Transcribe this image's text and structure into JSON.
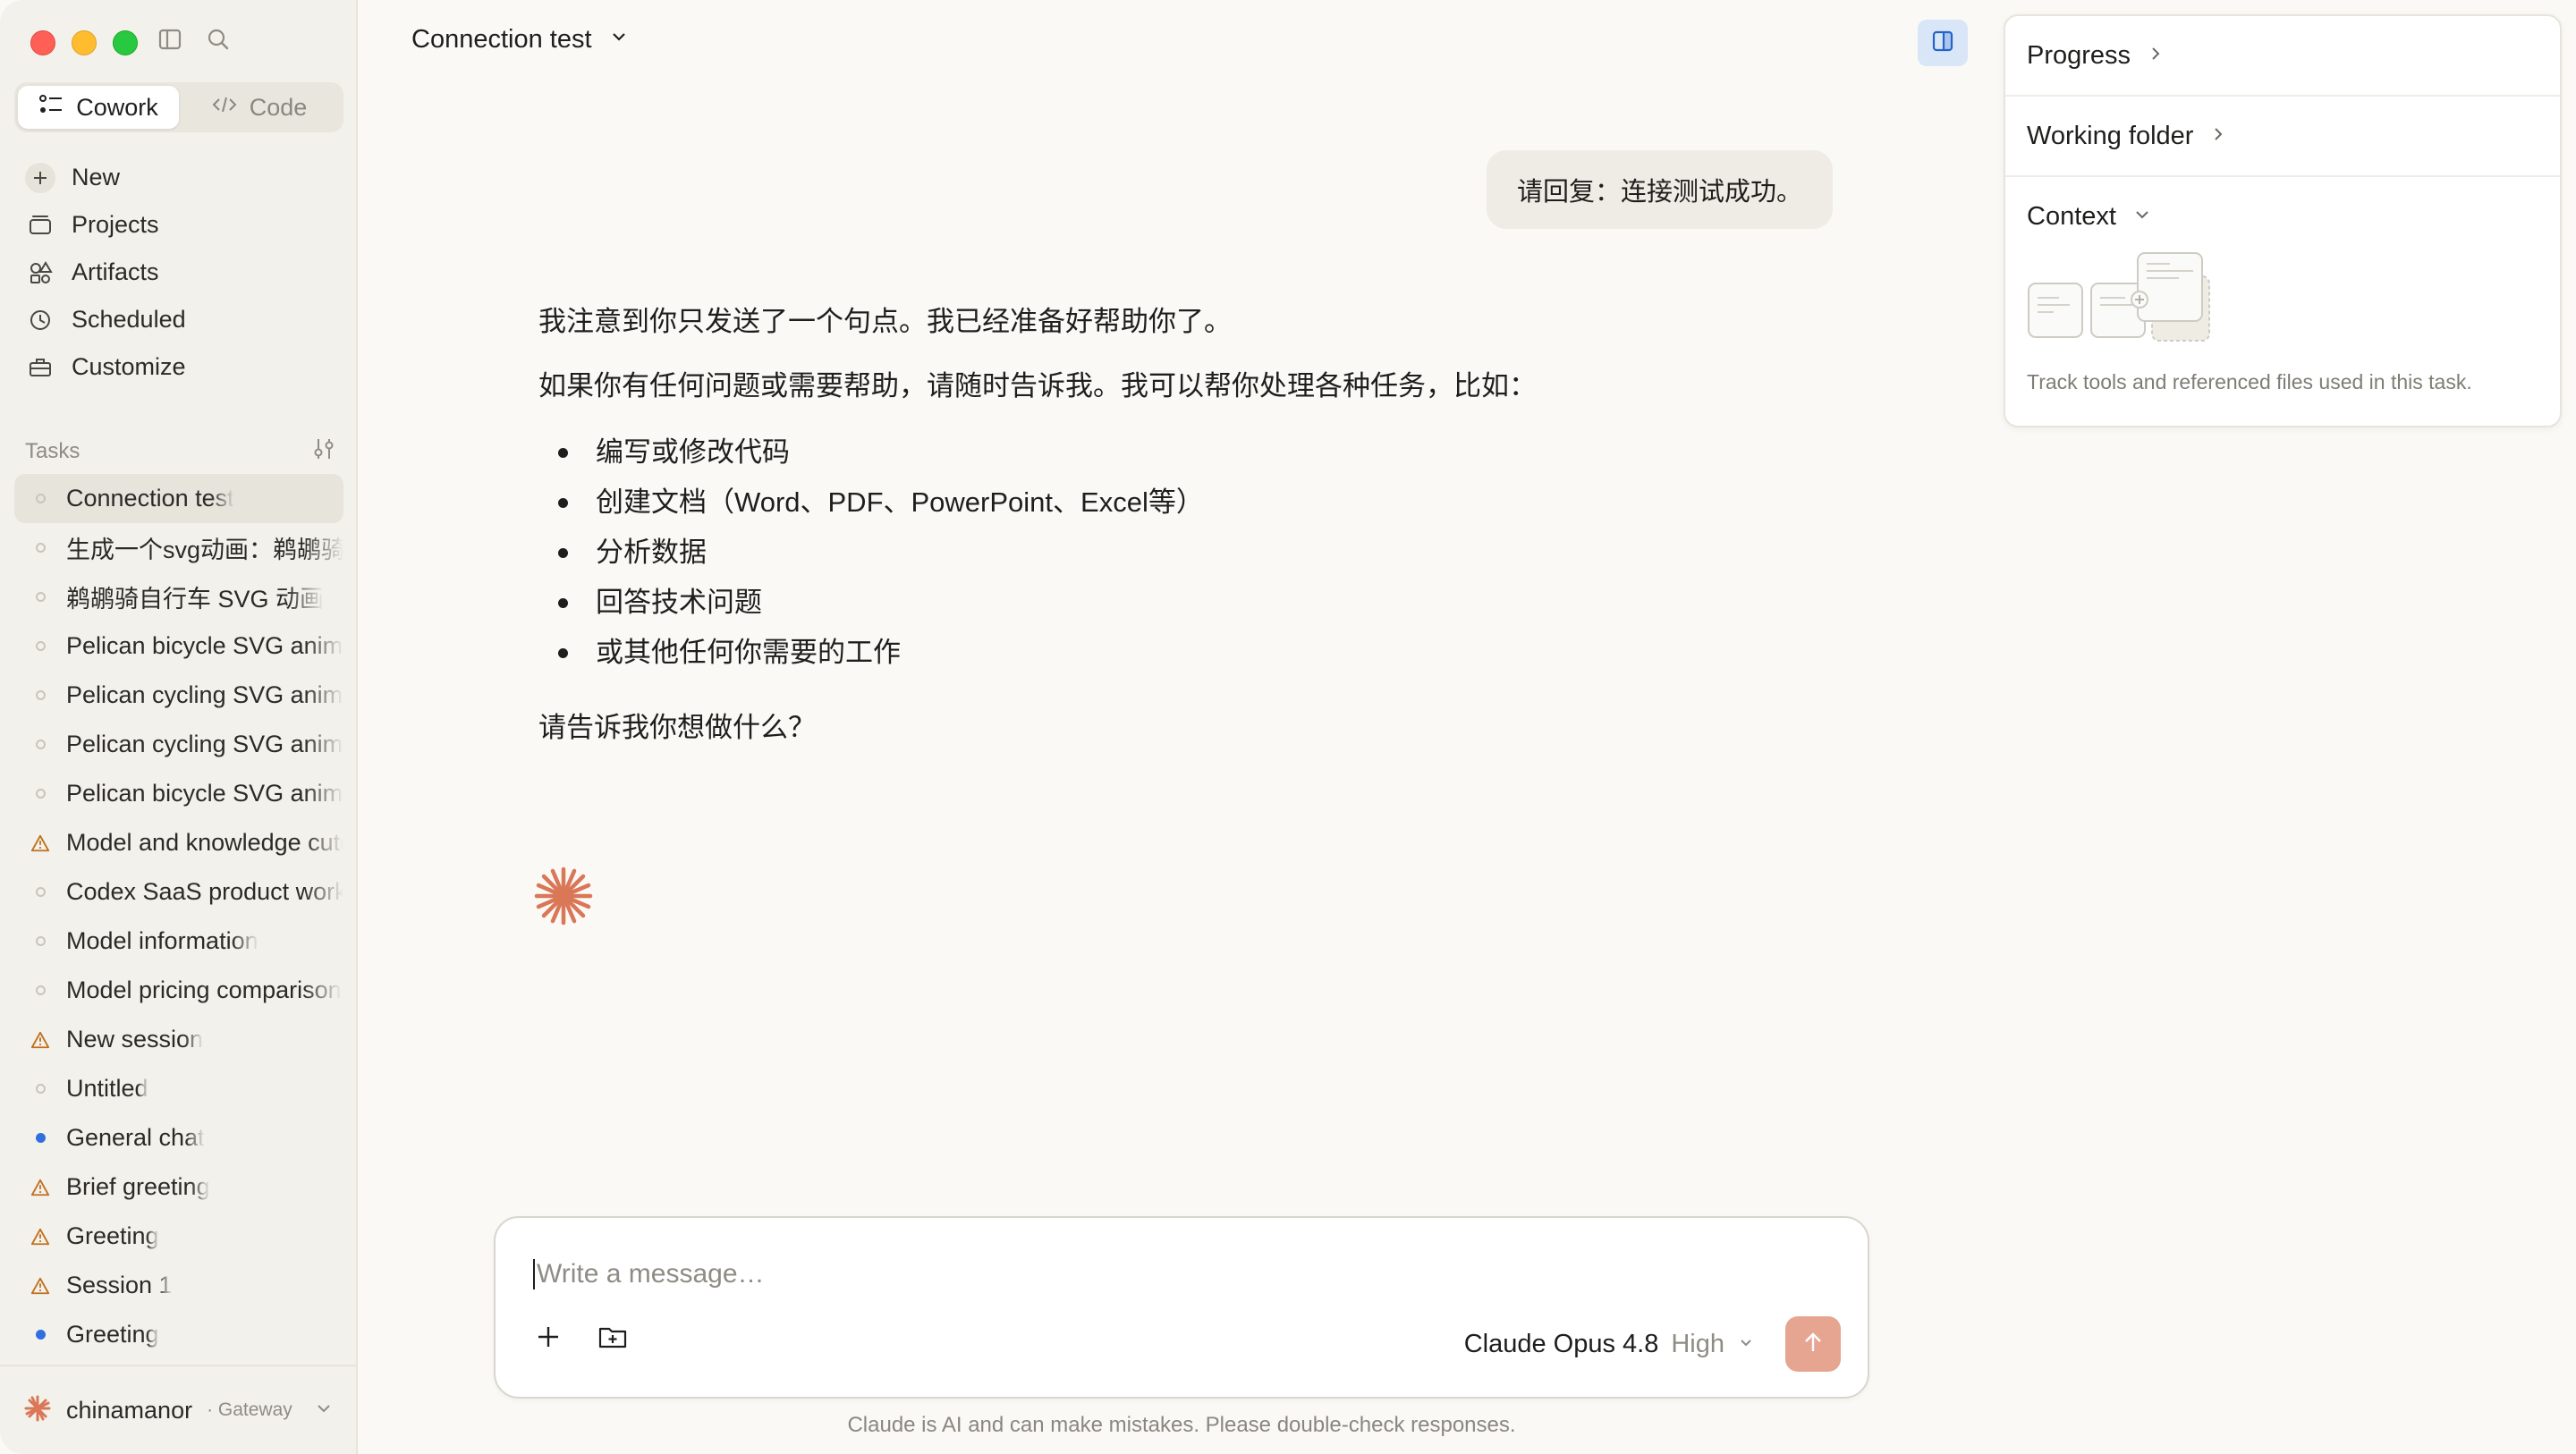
{
  "sidebar": {
    "modes": [
      {
        "label": "Cowork",
        "active": true
      },
      {
        "label": "Code",
        "active": false
      }
    ],
    "nav": [
      {
        "label": "New",
        "icon": "plus-icon"
      },
      {
        "label": "Projects",
        "icon": "folder-icon"
      },
      {
        "label": "Artifacts",
        "icon": "shapes-icon"
      },
      {
        "label": "Scheduled",
        "icon": "clock-icon"
      },
      {
        "label": "Customize",
        "icon": "briefcase-icon"
      }
    ],
    "tasks_label": "Tasks",
    "tasks": [
      {
        "label": "Connection test",
        "status": "idle",
        "active": true
      },
      {
        "label": "生成一个svg动画：鹈鹕骑自行车",
        "status": "idle"
      },
      {
        "label": "鹈鹕骑自行车 SVG 动画",
        "status": "idle"
      },
      {
        "label": "Pelican bicycle SVG animation",
        "status": "idle"
      },
      {
        "label": "Pelican cycling SVG animation",
        "status": "idle"
      },
      {
        "label": "Pelican cycling SVG animation",
        "status": "idle"
      },
      {
        "label": "Pelican bicycle SVG animation",
        "status": "idle"
      },
      {
        "label": "Model and knowledge cutoff",
        "status": "warning"
      },
      {
        "label": "Codex SaaS product workflow",
        "status": "idle"
      },
      {
        "label": "Model information",
        "status": "idle"
      },
      {
        "label": "Model pricing comparison",
        "status": "idle"
      },
      {
        "label": "New session",
        "status": "warning"
      },
      {
        "label": "Untitled",
        "status": "idle"
      },
      {
        "label": "General chat",
        "status": "active-blue"
      },
      {
        "label": "Brief greeting",
        "status": "warning"
      },
      {
        "label": "Greeting",
        "status": "warning"
      },
      {
        "label": "Session 1",
        "status": "warning"
      },
      {
        "label": "Greeting",
        "status": "active-blue"
      }
    ],
    "user": {
      "name": "chinamanor",
      "sub": "· Gateway"
    }
  },
  "header": {
    "title": "Connection test"
  },
  "conversation": {
    "user_message": "请回复：连接测试成功。",
    "assistant": {
      "p1": "我注意到你只发送了一个句点。我已经准备好帮助你了。",
      "p2": "如果你有任何问题或需要帮助，请随时告诉我。我可以帮你处理各种任务，比如：",
      "bullets": [
        "编写或修改代码",
        "创建文档（Word、PDF、PowerPoint、Excel等）",
        "分析数据",
        "回答技术问题",
        "或其他任何你需要的工作"
      ],
      "p3": "请告诉我你想做什么？"
    }
  },
  "composer": {
    "placeholder": "Write a message…",
    "model": "Claude Opus 4.8",
    "effort": "High",
    "disclaimer": "Claude is AI and can make mistakes. Please double-check responses."
  },
  "right_panel": {
    "progress": "Progress",
    "working_folder": "Working folder",
    "context": "Context",
    "context_desc": "Track tools and referenced files used in this task."
  },
  "colors": {
    "accent": "#d97757",
    "send_button": "#e6a591",
    "panel_toggle": "#d8e6f8",
    "warning": "#c0701f",
    "blue_dot": "#2f6fe0"
  }
}
